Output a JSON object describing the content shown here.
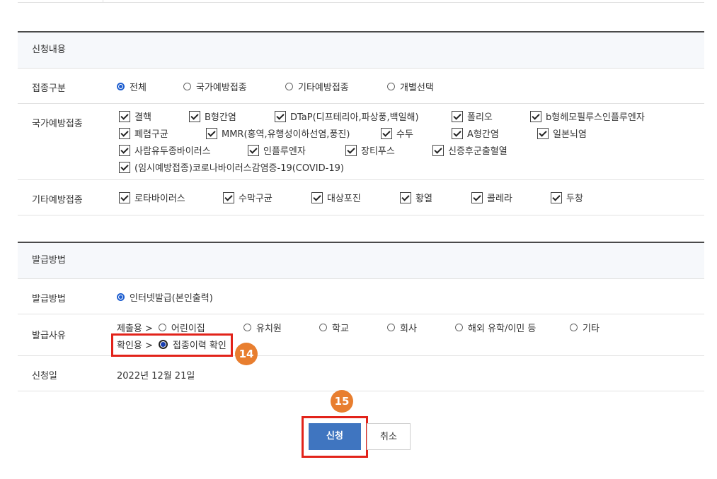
{
  "apply_section": {
    "title": "신청내용",
    "scope": {
      "label": "접종구분",
      "options": [
        "전체",
        "국가예방접종",
        "기타예방접종",
        "개별선택"
      ],
      "selected": "전체"
    },
    "national": {
      "label": "국가예방접종",
      "items": [
        "결핵",
        "B형간염",
        "DTaP(디프테리아,파상풍,백일해)",
        "폴리오",
        "b형헤모필루스인플루엔자",
        "폐렴구균",
        "MMR(홍역,유행성이하선염,풍진)",
        "수두",
        "A형간염",
        "일본뇌염",
        "사람유두종바이러스",
        "인플루엔자",
        "장티푸스",
        "신증후군출혈열",
        "(임시예방접종)코로나바이러스감염증-19(COVID-19)"
      ]
    },
    "other": {
      "label": "기타예방접종",
      "items": [
        "로타바이러스",
        "수막구균",
        "대상포진",
        "황열",
        "콜레라",
        "두창"
      ]
    }
  },
  "issue_section": {
    "title": "발급방법",
    "method": {
      "label": "발급방법",
      "option": "인터넷발급(본인출력)"
    },
    "reason": {
      "label": "발급사유",
      "submit_prefix": "제출용 >",
      "submit_options": [
        "어린이집",
        "유치원",
        "학교",
        "회사",
        "해외 유학/이민 등",
        "기타"
      ],
      "confirm_prefix": "확인용 >",
      "confirm_option": "접종이력 확인"
    },
    "date": {
      "label": "신청일",
      "value": "2022년 12월 21일"
    }
  },
  "buttons": {
    "apply": "신청",
    "cancel": "취소"
  },
  "annotations": {
    "step14": "14",
    "step15": "15"
  },
  "colors": {
    "highlight": "#e2231a",
    "badge": "#e87e2f",
    "primary": "#3f75c0",
    "section_bg": "#f6f8fb"
  }
}
